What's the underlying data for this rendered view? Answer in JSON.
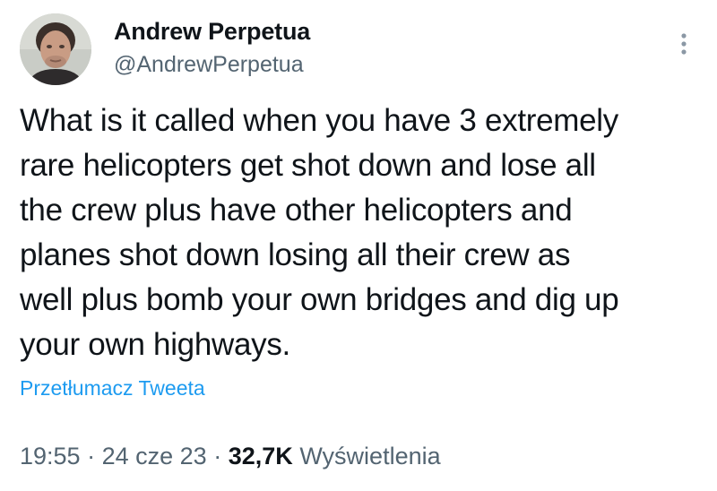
{
  "author": {
    "name": "Andrew Perpetua",
    "handle": "@AndrewPerpetua"
  },
  "tweet": {
    "text": "What is it called when you have 3 extremely\nrare helicopters get shot down and lose all\nthe crew plus have other helicopters and\nplanes shot down losing all their crew as\nwell plus bomb your own bridges and dig up\nyour own highways.",
    "translate_label": "Przetłumacz Tweeta"
  },
  "meta": {
    "time": "19:55",
    "separator": "·",
    "date": "24 cze 23",
    "views_count": "32,7K",
    "views_label": "Wyświetlenia"
  },
  "icons": {
    "more": "more-vertical-icon",
    "avatar": "avatar"
  },
  "colors": {
    "text_primary": "#0f1419",
    "text_secondary": "#536471",
    "link": "#1d9bf0",
    "background": "#ffffff"
  }
}
